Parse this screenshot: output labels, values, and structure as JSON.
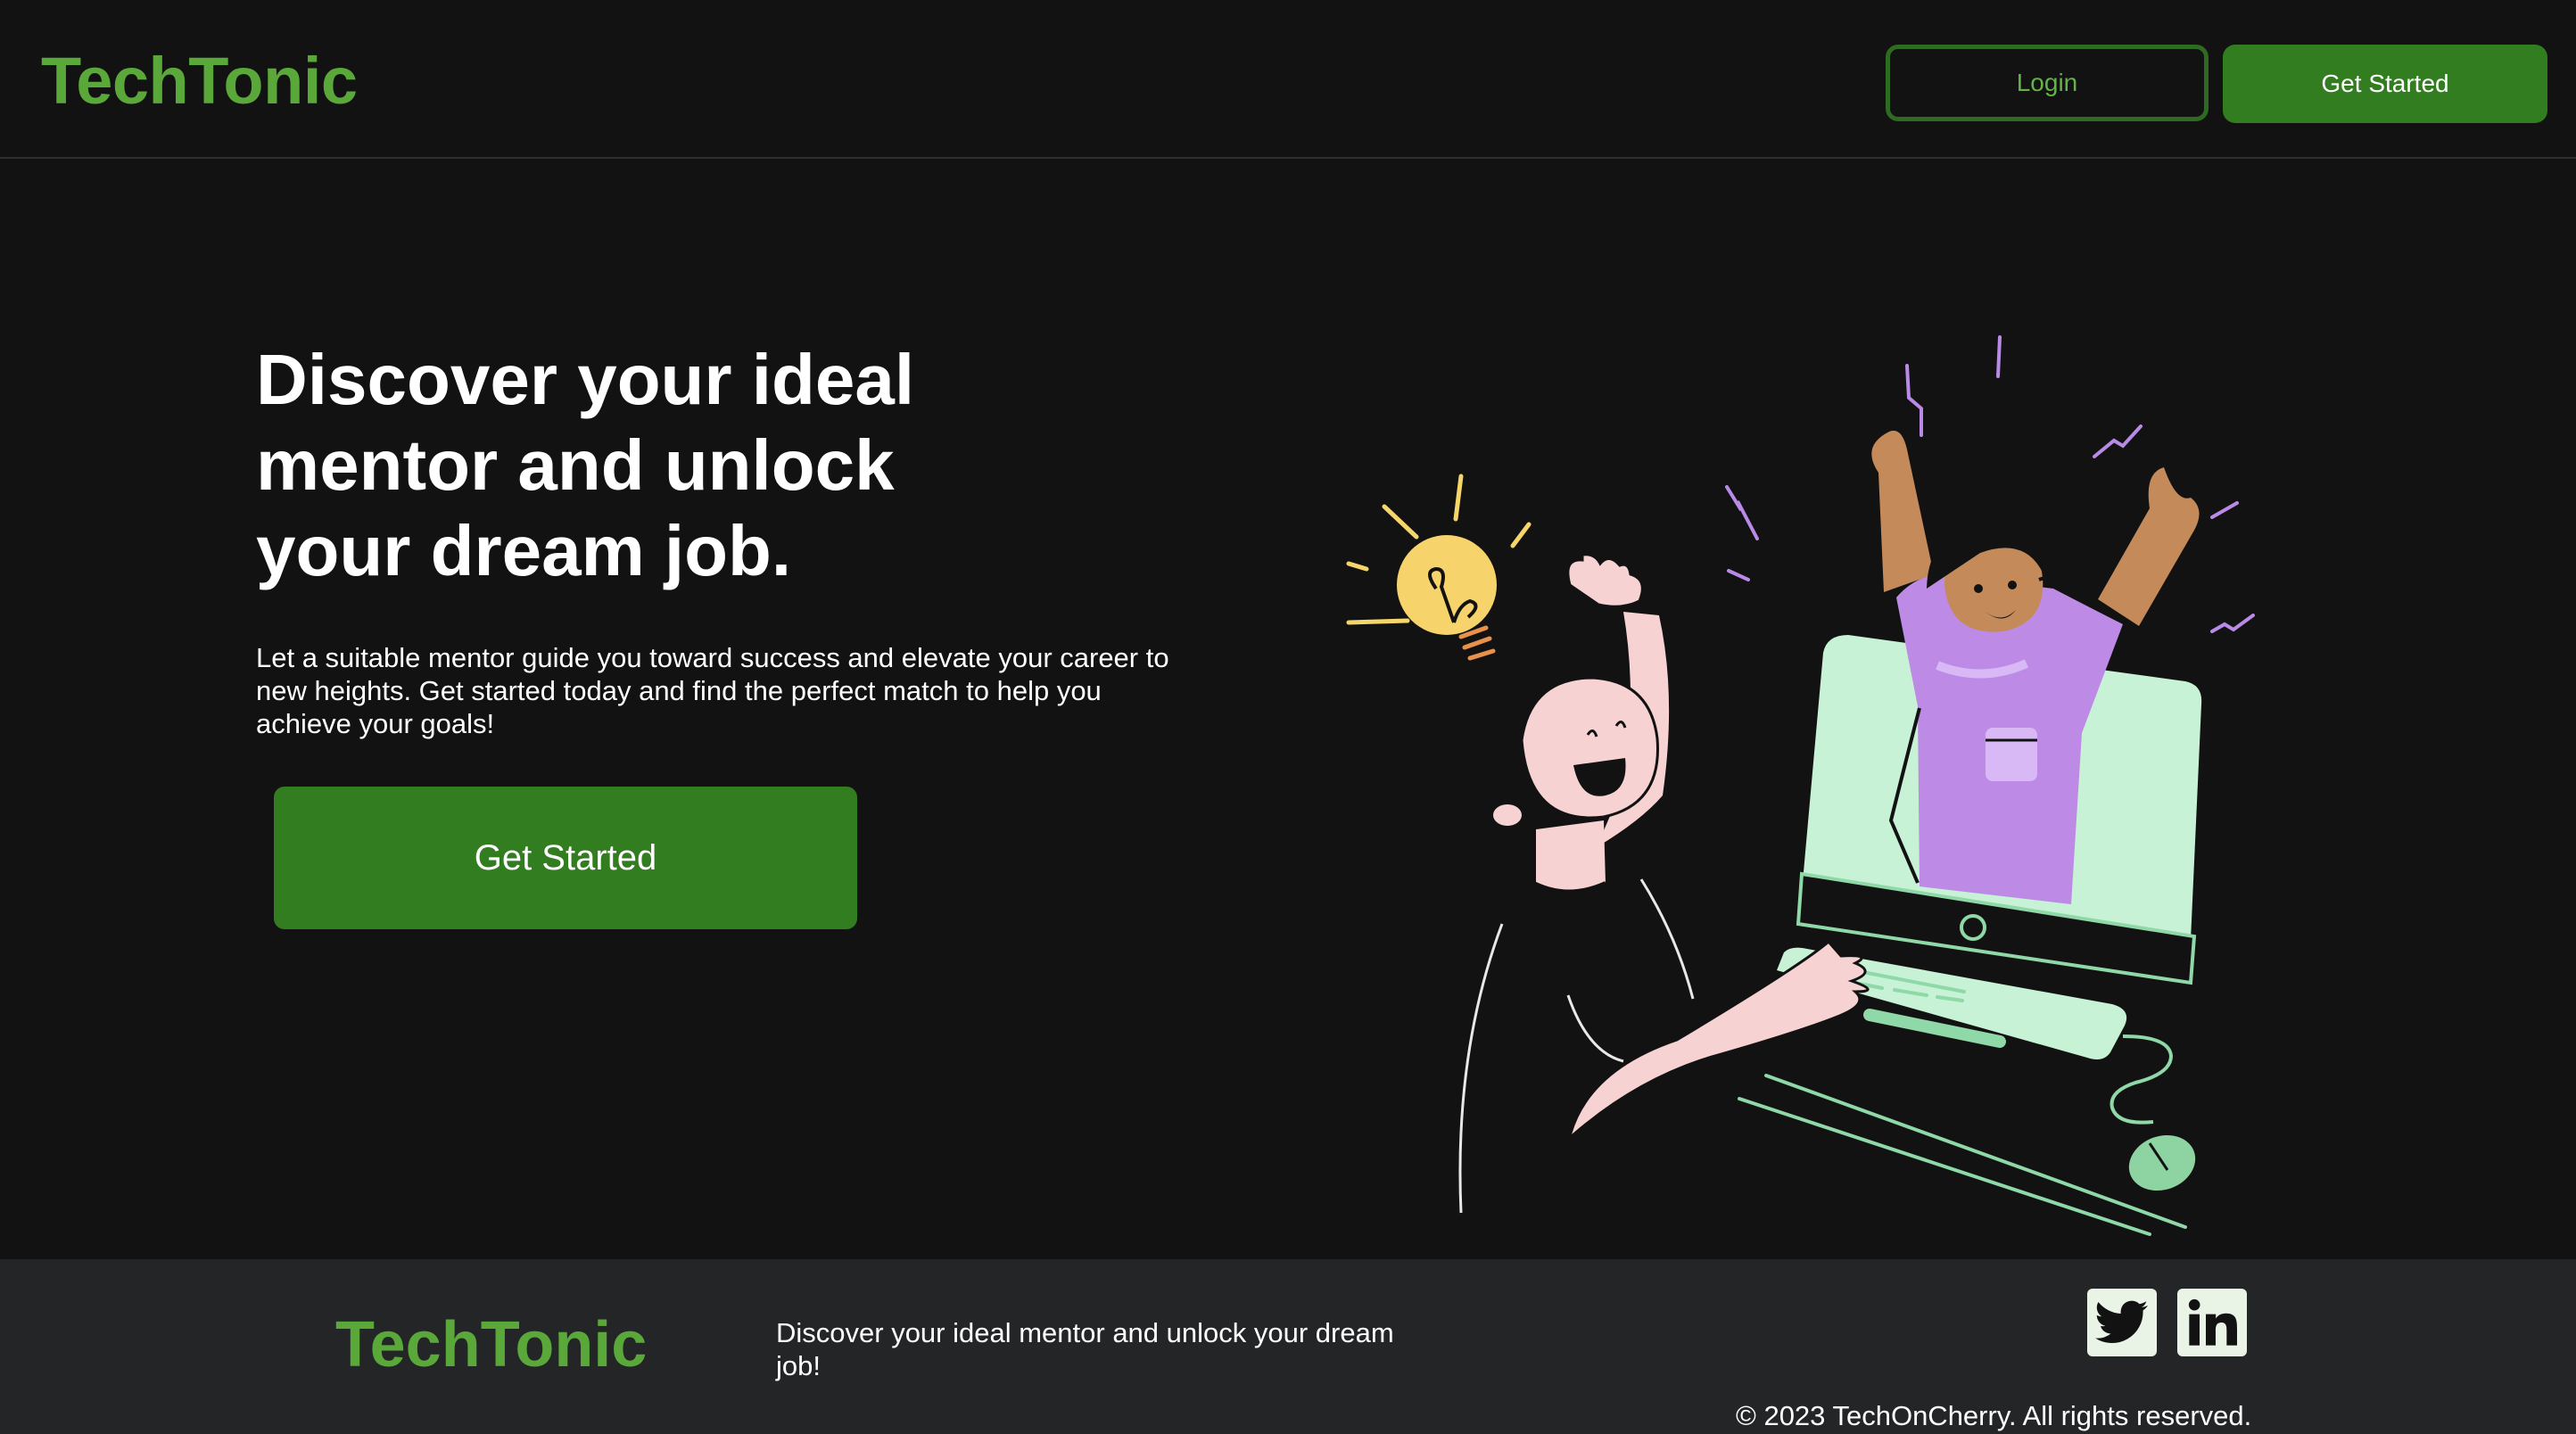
{
  "brand": {
    "name": "TechTonic",
    "color": "#5aa83a"
  },
  "header": {
    "login_label": "Login",
    "get_started_label": "Get Started"
  },
  "hero": {
    "title": "Discover your ideal mentor and unlock your dream job.",
    "description": "Let a suitable mentor guide you toward success and elevate your career to new heights. Get started today and find the perfect match to help you achieve your goals!",
    "cta_label": "Get Started",
    "illustration": "mentor-celebration-illustration"
  },
  "footer": {
    "tagline": "Discover your ideal mentor and unlock your dream job!",
    "social": [
      {
        "icon": "twitter-icon"
      },
      {
        "icon": "linkedin-icon"
      }
    ],
    "copyright": "© 2023 TechOnCherry. All rights reserved."
  },
  "colors": {
    "background": "#121212",
    "footer_background": "#242527",
    "primary_button": "#327d20",
    "login_border": "#2f6a22"
  }
}
